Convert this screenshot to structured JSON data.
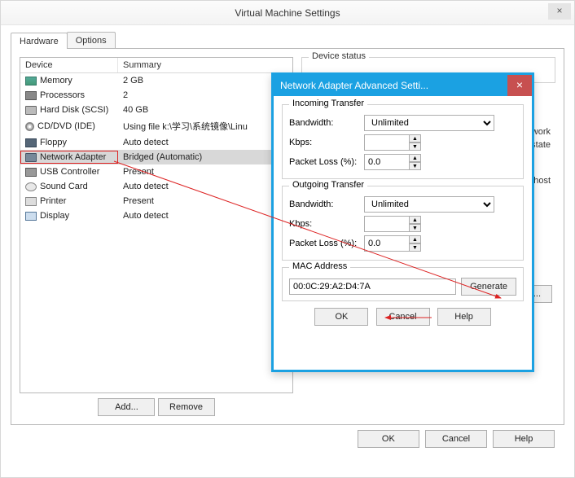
{
  "window": {
    "title": "Virtual Machine Settings",
    "close": "×",
    "tabs": {
      "hardware": "Hardware",
      "options": "Options"
    },
    "device_header": {
      "device": "Device",
      "summary": "Summary"
    },
    "devices": [
      {
        "icon": "ic-mem",
        "name": "Memory",
        "summary": "2 GB"
      },
      {
        "icon": "ic-cpu",
        "name": "Processors",
        "summary": "2"
      },
      {
        "icon": "ic-hdd",
        "name": "Hard Disk (SCSI)",
        "summary": "40 GB"
      },
      {
        "icon": "ic-cd",
        "name": "CD/DVD (IDE)",
        "summary": "Using file k:\\学习\\系统镜像\\Linu"
      },
      {
        "icon": "ic-floppy",
        "name": "Floppy",
        "summary": "Auto detect"
      },
      {
        "icon": "ic-net",
        "name": "Network Adapter",
        "summary": "Bridged (Automatic)"
      },
      {
        "icon": "ic-usb",
        "name": "USB Controller",
        "summary": "Present"
      },
      {
        "icon": "ic-snd",
        "name": "Sound Card",
        "summary": "Auto detect"
      },
      {
        "icon": "ic-prn",
        "name": "Printer",
        "summary": "Present"
      },
      {
        "icon": "ic-disp",
        "name": "Display",
        "summary": "Auto detect"
      }
    ],
    "add_btn": "Add...",
    "remove_btn": "Remove",
    "ok": "OK",
    "cancel": "Cancel",
    "help": "Help"
  },
  "right": {
    "device_status_legend": "Device status",
    "snippet_line1": "al network",
    "snippet_line2": "state",
    "snippet_line3": "the host",
    "advanced_btn": "Advanced..."
  },
  "adv": {
    "title": "Network Adapter Advanced Setti...",
    "close": "×",
    "incoming_legend": "Incoming Transfer",
    "outgoing_legend": "Outgoing Transfer",
    "bandwidth_label": "Bandwidth:",
    "bandwidth_value": "Unlimited",
    "kbps_label": "Kbps:",
    "kbps_value": "",
    "packetloss_label": "Packet Loss (%):",
    "packetloss_value": "0.0",
    "mac_legend": "MAC Address",
    "mac_value": "00:0C:29:A2:D4:7A",
    "generate_btn": "Generate",
    "ok": "OK",
    "cancel": "Cancel",
    "help": "Help"
  }
}
